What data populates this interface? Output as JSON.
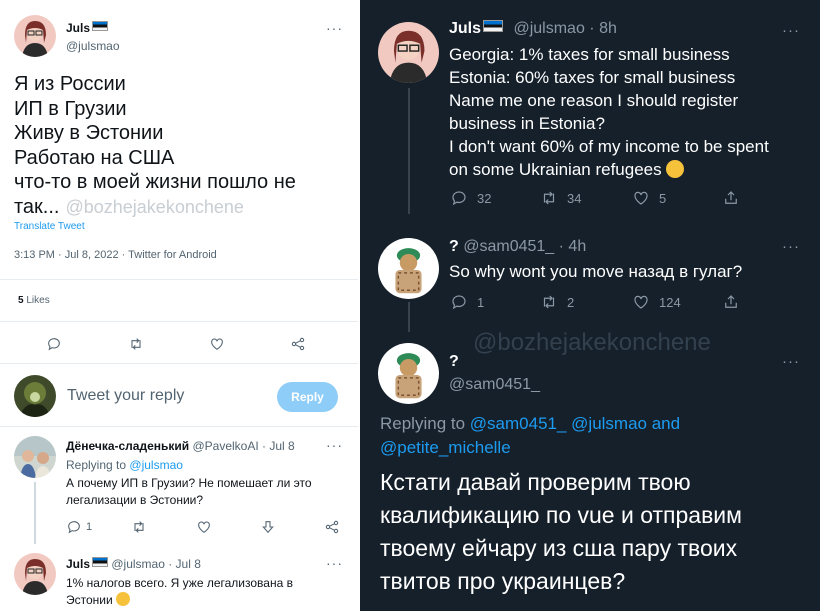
{
  "left": {
    "main_tweet": {
      "name": "Juls",
      "handle": "@julsmao",
      "lines": [
        "Я из России",
        "ИП в Грузии",
        "Живу в Эстонии",
        "Работаю на США",
        "что-то в моей жизни пошло не",
        "так..."
      ],
      "watermark": "@bozhejakekonchene",
      "translate": "Translate Tweet",
      "meta": "3:13 PM · Jul 8, 2022 · Twitter for Android",
      "likes_count": "5",
      "likes_label": "Likes"
    },
    "reply_box": {
      "placeholder": "Tweet your reply",
      "button": "Reply"
    },
    "comment1": {
      "name": "Дёнечка-сладенький",
      "handle_time": "@PavelkoAI · Jul 8",
      "replying_prefix": "Replying to",
      "replying_handle": "@julsmao",
      "text": "А почему ИП в Грузии? Не помешает ли это легализации в Эстонии?",
      "reply_count": "1"
    },
    "comment2": {
      "name": "Juls",
      "handle_time": "@julsmao · Jul 8",
      "text": "1% налогов всего. Я уже легализована в Эстонии"
    }
  },
  "right": {
    "tweet1": {
      "name": "Juls",
      "handle_time": "@julsmao · 8h",
      "text_lines": [
        "Georgia: 1% taxes for small business",
        "Estonia: 60% taxes for small business",
        "Name me one reason I should register",
        "business in Estonia?",
        "I don't want 60% of my income to be spent",
        "on some Ukrainian refugees"
      ],
      "replies": "32",
      "retweets": "34",
      "likes": "5"
    },
    "tweet2": {
      "name": "?",
      "handle_time": "@sam0451_ · 4h",
      "text": "So why wont you move назад в гулаг?",
      "replies": "1",
      "retweets": "2",
      "likes": "124"
    },
    "watermark": "@bozhejakekonchene",
    "tweet3": {
      "name": "?",
      "handle": "@sam0451_",
      "replying_prefix": "Replying to",
      "replying_handles": "@sam0451_ @julsmao and",
      "replying_handles2": "@petite_michelle",
      "text": "Кстати давай проверим твою квалификацию по vue и отправим твоему ейчару из сша пару твоих твитов про украинцев?"
    }
  }
}
